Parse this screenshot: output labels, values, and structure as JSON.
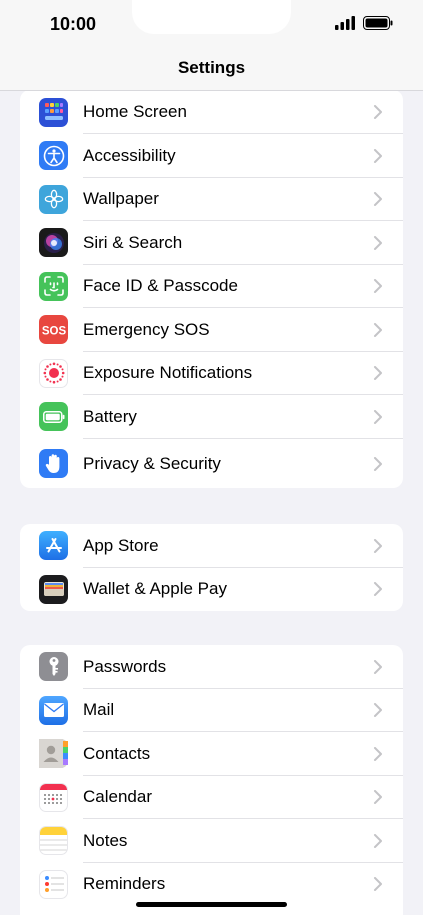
{
  "status": {
    "time": "10:00"
  },
  "nav": {
    "title": "Settings"
  },
  "groups": [
    {
      "items": [
        {
          "label": "Home Screen",
          "icon": "home-screen-icon",
          "color": "#2c50d6"
        },
        {
          "label": "Accessibility",
          "icon": "accessibility-icon",
          "color": "#2f7bf5"
        },
        {
          "label": "Wallpaper",
          "icon": "wallpaper-icon",
          "color": "#3ea5db"
        },
        {
          "label": "Siri & Search",
          "icon": "siri-icon",
          "color": "#1a1a1a"
        },
        {
          "label": "Face ID & Passcode",
          "icon": "face-id-icon",
          "color": "#45c35a"
        },
        {
          "label": "Emergency SOS",
          "icon": "sos-icon",
          "color": "#e8473f"
        },
        {
          "label": "Exposure Notifications",
          "icon": "exposure-icon",
          "color": "#ffffff"
        },
        {
          "label": "Battery",
          "icon": "battery-icon",
          "color": "#45c35a"
        },
        {
          "label": "Privacy & Security",
          "icon": "privacy-hand-icon",
          "color": "#2f7bf5"
        }
      ]
    },
    {
      "items": [
        {
          "label": "App Store",
          "icon": "app-store-icon",
          "color": "#2a8cf0"
        },
        {
          "label": "Wallet & Apple Pay",
          "icon": "wallet-icon",
          "color": "#1c1c1e"
        }
      ]
    },
    {
      "items": [
        {
          "label": "Passwords",
          "icon": "passwords-key-icon",
          "color": "#8e8e93"
        },
        {
          "label": "Mail",
          "icon": "mail-icon",
          "color": "#2f7bf5"
        },
        {
          "label": "Contacts",
          "icon": "contacts-icon",
          "color": "#d9d6d2"
        },
        {
          "label": "Calendar",
          "icon": "calendar-icon",
          "color": "#ffffff"
        },
        {
          "label": "Notes",
          "icon": "notes-icon",
          "color": "#ffffff"
        },
        {
          "label": "Reminders",
          "icon": "reminders-icon",
          "color": "#ffffff"
        }
      ]
    }
  ]
}
